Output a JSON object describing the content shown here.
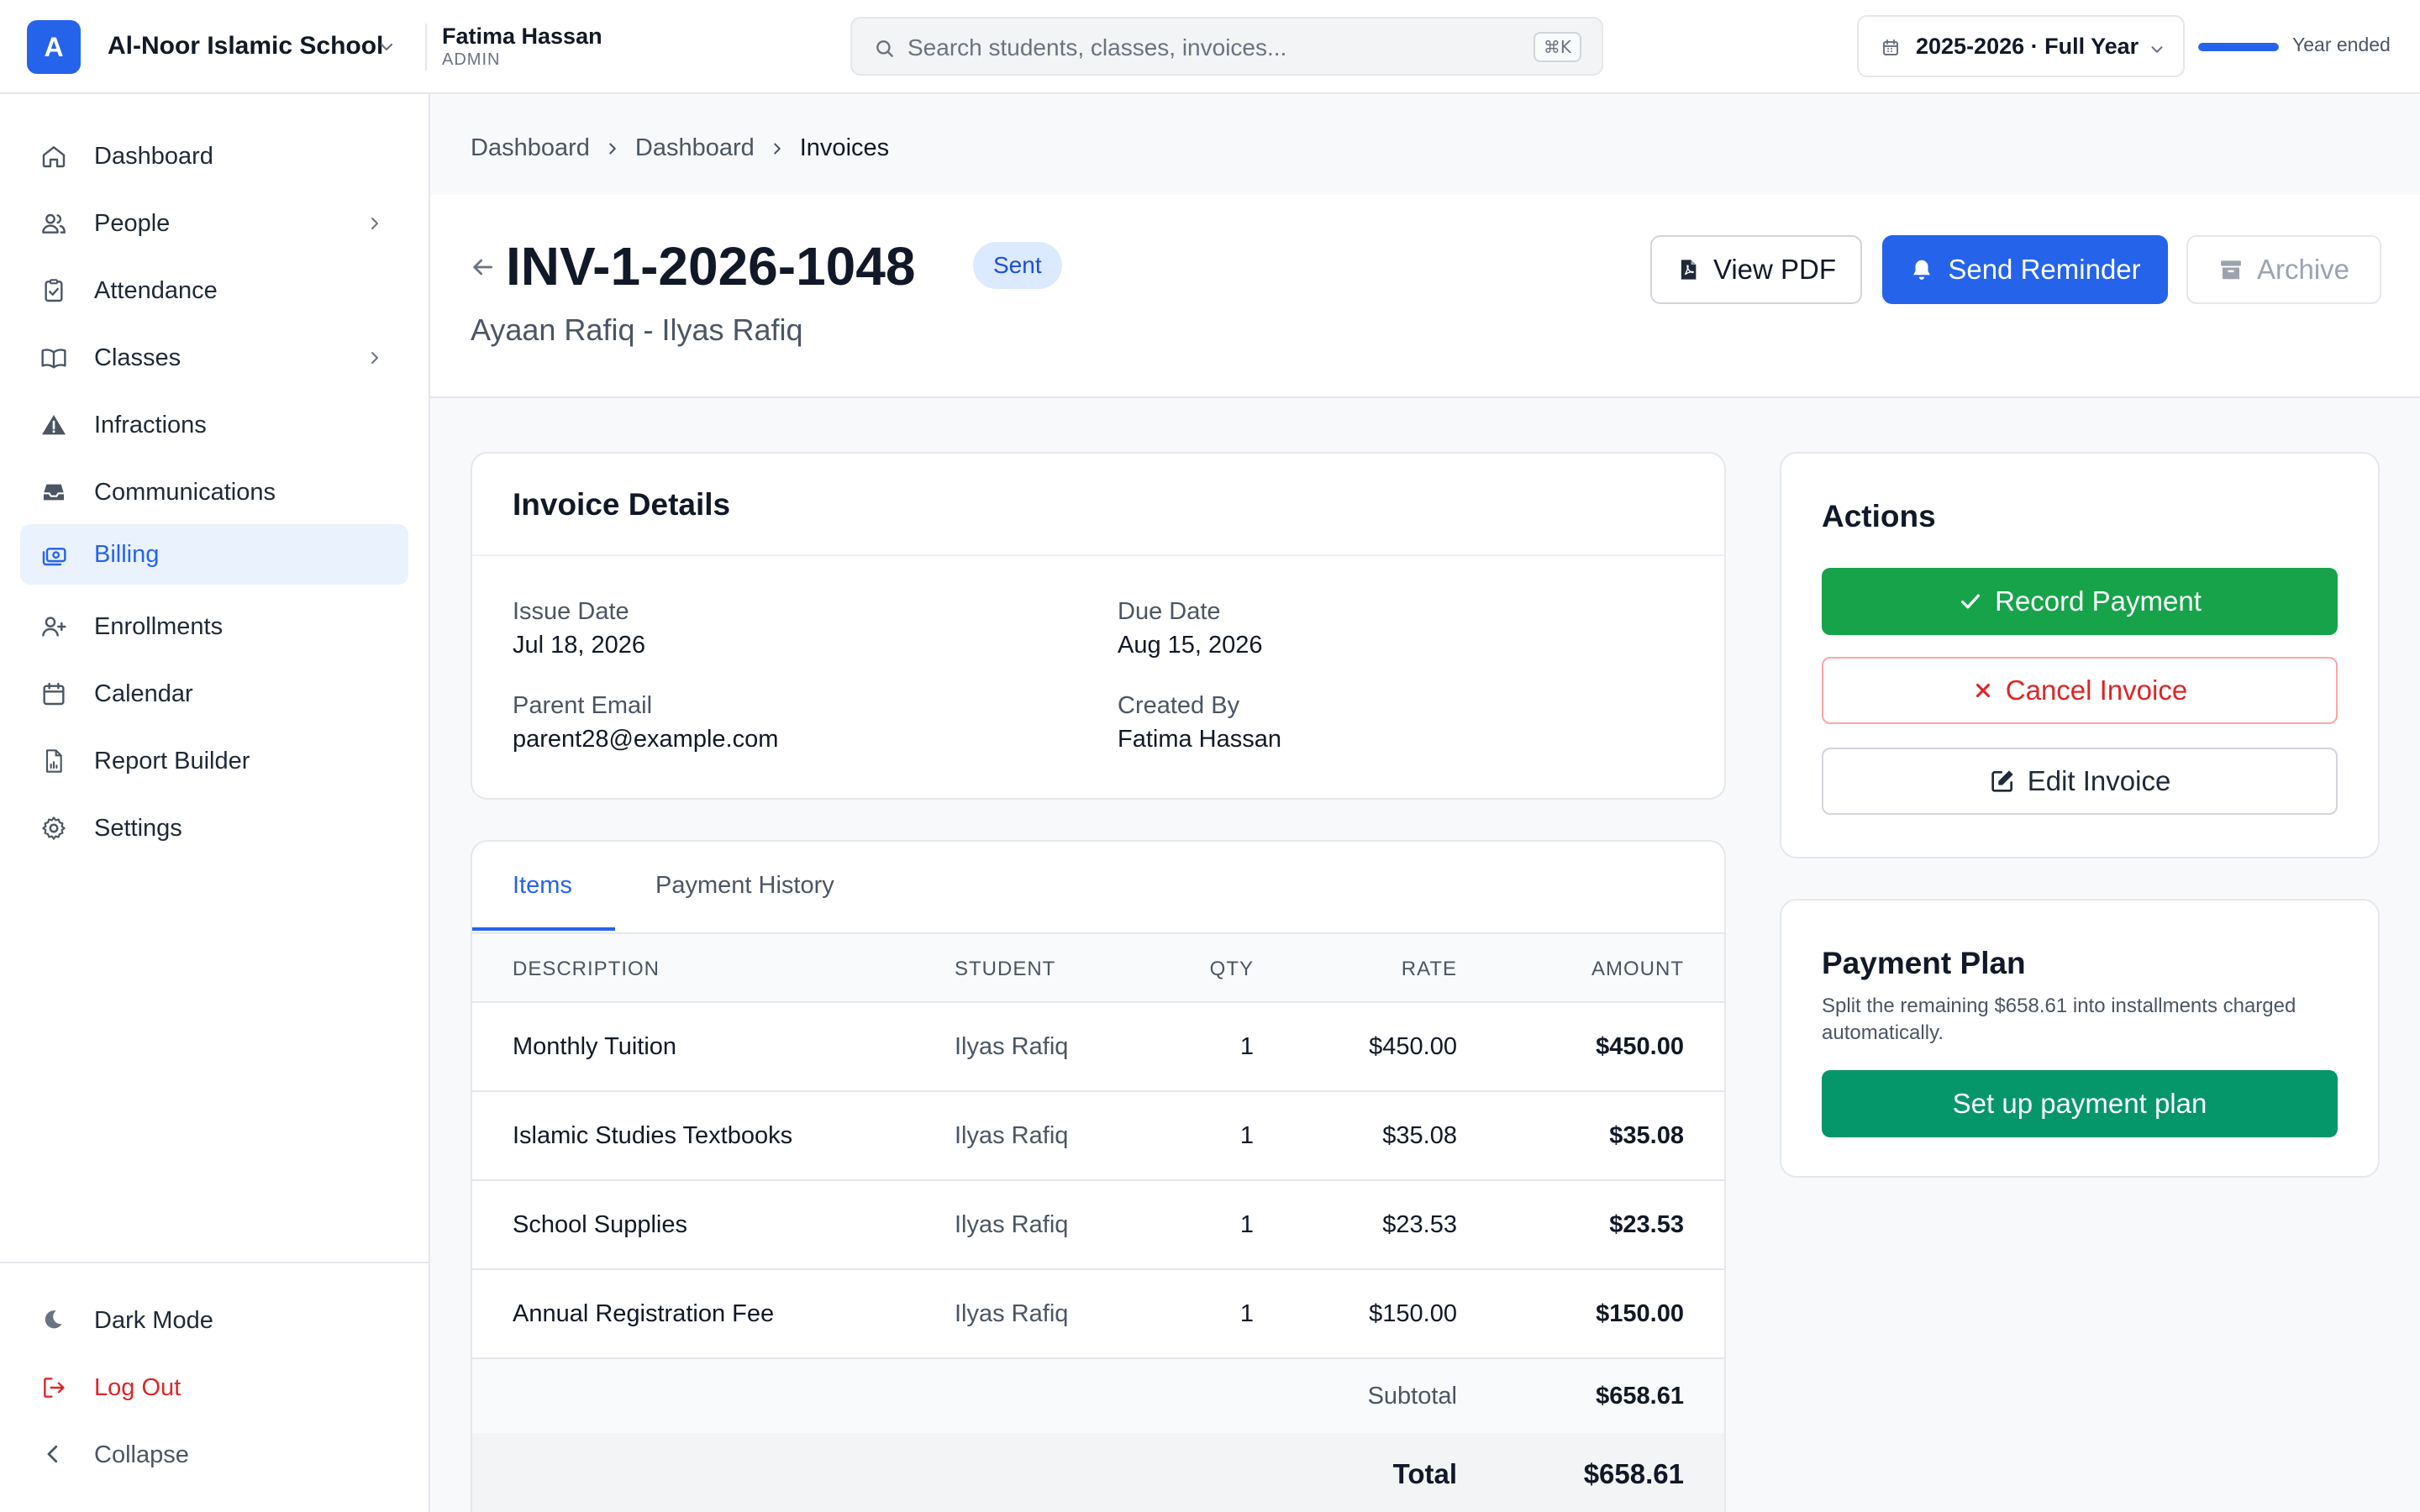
{
  "topbar": {
    "logo_letter": "A",
    "school_name": "Al-Noor Islamic School",
    "user_name": "Fatima Hassan",
    "user_role": "ADMIN",
    "search_placeholder": "Search students, classes, invoices...",
    "search_shortcut": "⌘K",
    "year_label": "2025-2026 · Full Year",
    "year_progress": 1.0,
    "year_status": "Year ended"
  },
  "sidebar": {
    "items": [
      {
        "label": "Dashboard",
        "icon": "home-icon"
      },
      {
        "label": "People",
        "icon": "users-icon",
        "has_submenu": true
      },
      {
        "label": "Attendance",
        "icon": "clipboard-check-icon"
      },
      {
        "label": "Classes",
        "icon": "book-open-icon",
        "has_submenu": true
      },
      {
        "label": "Infractions",
        "icon": "warning-triangle-icon"
      },
      {
        "label": "Communications",
        "icon": "inbox-icon"
      },
      {
        "label": "Billing",
        "icon": "cash-icon",
        "active": true
      },
      {
        "label": "Enrollments",
        "icon": "user-plus-icon"
      },
      {
        "label": "Calendar",
        "icon": "calendar-icon"
      },
      {
        "label": "Report Builder",
        "icon": "report-icon"
      },
      {
        "label": "Settings",
        "icon": "gear-icon"
      }
    ],
    "bottom": {
      "dark_mode": "Dark Mode",
      "log_out": "Log Out",
      "collapse": "Collapse"
    }
  },
  "breadcrumb": [
    "Dashboard",
    "Dashboard",
    "Invoices"
  ],
  "invoice": {
    "number": "INV-1-2026-1048",
    "status": "Sent",
    "subtitle": "Ayaan Rafiq - Ilyas Rafiq",
    "buttons": {
      "view_pdf": "View PDF",
      "send_reminder": "Send Reminder",
      "archive": "Archive"
    }
  },
  "details": {
    "title": "Invoice Details",
    "issue_date_label": "Issue Date",
    "issue_date": "Jul 18, 2026",
    "due_date_label": "Due Date",
    "due_date": "Aug 15, 2026",
    "parent_email_label": "Parent Email",
    "parent_email": "parent28@example.com",
    "created_by_label": "Created By",
    "created_by": "Fatima Hassan"
  },
  "tabs": [
    "Items",
    "Payment History"
  ],
  "table": {
    "headers": [
      "DESCRIPTION",
      "STUDENT",
      "QTY",
      "RATE",
      "AMOUNT"
    ],
    "rows": [
      {
        "description": "Monthly Tuition",
        "student": "Ilyas Rafiq",
        "qty": "1",
        "rate": "$450.00",
        "amount": "$450.00"
      },
      {
        "description": "Islamic Studies Textbooks",
        "student": "Ilyas Rafiq",
        "qty": "1",
        "rate": "$35.08",
        "amount": "$35.08"
      },
      {
        "description": "School Supplies",
        "student": "Ilyas Rafiq",
        "qty": "1",
        "rate": "$23.53",
        "amount": "$23.53"
      },
      {
        "description": "Annual Registration Fee",
        "student": "Ilyas Rafiq",
        "qty": "1",
        "rate": "$150.00",
        "amount": "$150.00"
      }
    ],
    "subtotal_label": "Subtotal",
    "subtotal": "$658.61",
    "total_label": "Total",
    "total": "$658.61"
  },
  "actions": {
    "title": "Actions",
    "record_payment": "Record Payment",
    "cancel_invoice": "Cancel Invoice",
    "edit_invoice": "Edit Invoice"
  },
  "payment_plan": {
    "title": "Payment Plan",
    "description": "Split the remaining $658.61 into installments charged automatically.",
    "button": "Set up payment plan"
  },
  "colors": {
    "brand": "#2563eb",
    "success": "#16a34a",
    "danger": "#dc2626",
    "plan": "#059669"
  }
}
